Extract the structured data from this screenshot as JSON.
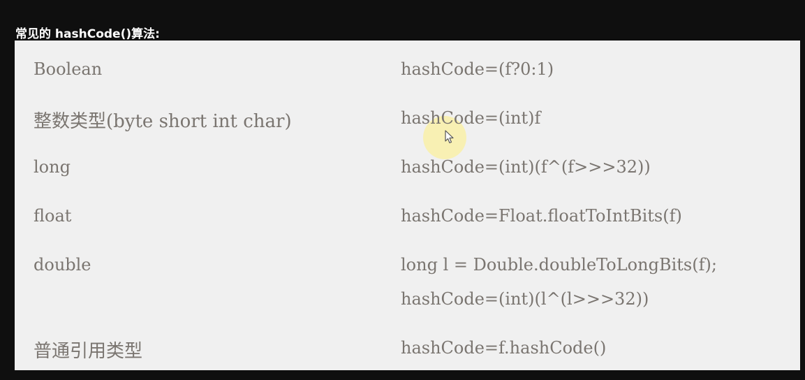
{
  "heading": "常见的 hashCode()算法:",
  "rows": [
    {
      "type": "Boolean",
      "code": "hashCode=(f?0:1)"
    },
    {
      "type": "整数类型(byte   short    int   char)",
      "code": "hashCode=(int)f"
    },
    {
      "type": "long",
      "code": "hashCode=(int)(f^(f>>>32))"
    },
    {
      "type": "float",
      "code": "hashCode=Float.floatToIntBits(f)"
    },
    {
      "type": "double",
      "code": "long l = Double.doubleToLongBits(f);",
      "code2": "hashCode=(int)(l^(l>>>32))"
    },
    {
      "type": "普通引用类型",
      "code": "hashCode=f.hashCode()"
    }
  ],
  "cursor_icon": "mouse-pointer-icon",
  "colors": {
    "background": "#0f0f0f",
    "panel": "#f0f0f0",
    "text": "#7a7570",
    "heading_text": "#ffffff",
    "highlight": "#fff082"
  }
}
